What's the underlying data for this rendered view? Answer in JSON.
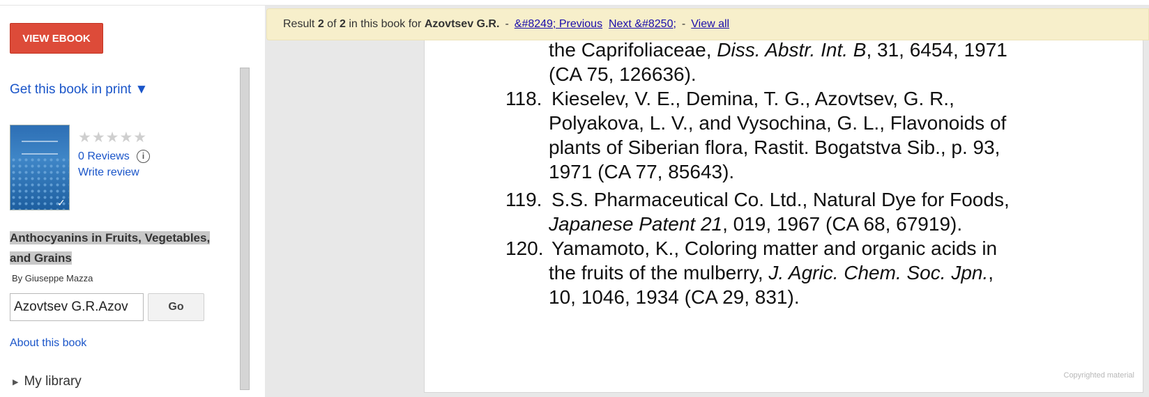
{
  "sidebar": {
    "view_ebook_label": "VIEW EBOOK",
    "get_print_label": "Get this book in print ▼",
    "reviews_label": "0 Reviews",
    "info_icon_glyph": "i",
    "write_review_label": "Write review",
    "stars_glyph": "★★★★★",
    "rating_stars": 0,
    "book_title_line1": "Anthocyanins in Fruits, Vegetables,",
    "book_title_line2": "and Grains",
    "author": "By Giuseppe Mazza",
    "search_value": "Azovtsev G.R.Azov",
    "go_label": "Go",
    "about_label": "About this book",
    "my_library_label": "My library",
    "my_library_icon": "triangle-right-icon"
  },
  "result_bar": {
    "prefix": "Result",
    "current": "2",
    "of": "of",
    "total": "2",
    "middle": "in this book for",
    "query": "Azovtsev G.R.",
    "dash1": "-",
    "previous_label": "&#8249; Previous",
    "next_label": "Next &#8250;",
    "dash2": "-",
    "view_all_label": "View all"
  },
  "page": {
    "top_line_1": "the Caprifoliaceae, Diss. Abstr. Int. B, 31, 6454, 1971",
    "top_line_2": "(CA 75, 126636).",
    "refs": [
      {
        "num": "118.",
        "lines": [
          "Kieselev, V. E., Demina, T. G., Azovtsev, G. R.,",
          "Polyakova, L. V., and Vysochina, G. L., Flavonoids of",
          "plants of Siberian flora, Rastit. Bogatstva Sib., p. 93,",
          "1971 (CA 77, 85643)."
        ]
      },
      {
        "num": "119.",
        "lines": [
          "S.S. Pharmaceutical Co. Ltd., Natural Dye for Foods,",
          "Japanese Patent 21, 019, 1967 (CA 68, 67919)."
        ]
      },
      {
        "num": "120.",
        "lines": [
          "Yamamoto, K., Coloring matter and organic acids in",
          "the fruits of the mulberry, J. Agric. Chem. Soc. Jpn.,",
          "10, 1046, 1934 (CA 29, 831)."
        ]
      }
    ],
    "copyright": "Copyrighted material"
  },
  "colors": {
    "accent_red": "#dd4b39",
    "link_blue": "#1a55c9",
    "result_bar_bg": "#f7efcb"
  }
}
